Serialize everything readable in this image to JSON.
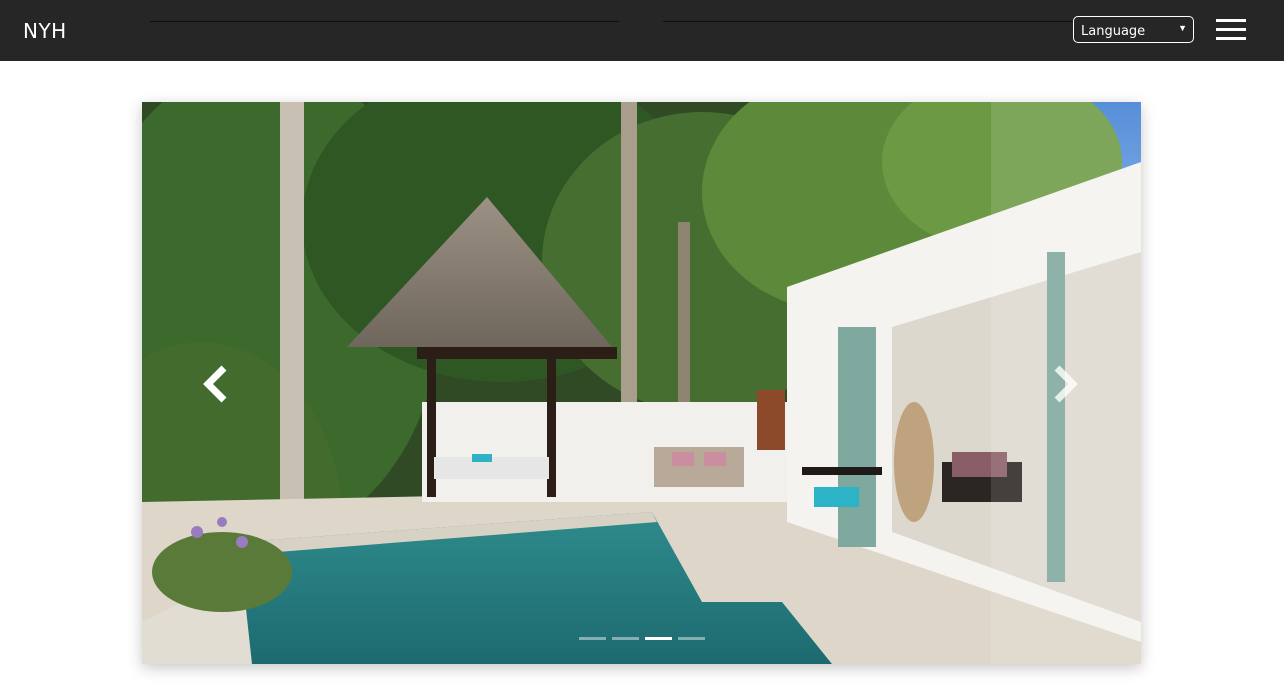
{
  "header": {
    "brand": "NYH",
    "language_select": {
      "selected": "Language",
      "icon": "caret-down-icon"
    },
    "menu_icon": "hamburger-menu-icon"
  },
  "carousel": {
    "slide_count": 4,
    "active_index": 2,
    "prev_icon": "chevron-left-icon",
    "next_icon": "chevron-right-icon"
  },
  "colors": {
    "header_bg": "#262626",
    "page_bg": "#ffffff",
    "accent_text": "#ffffff"
  }
}
